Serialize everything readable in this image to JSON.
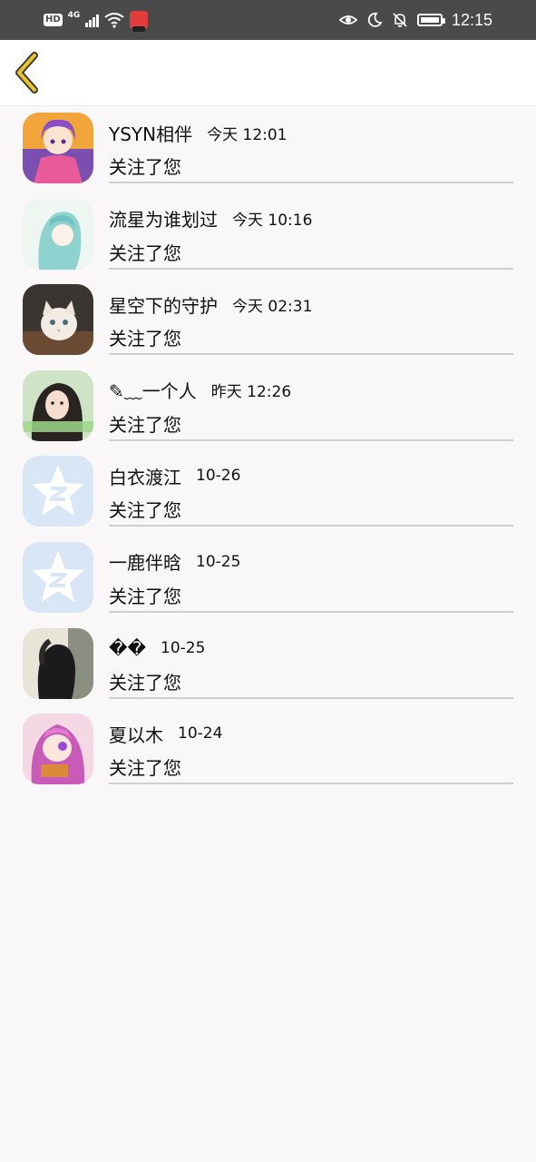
{
  "status_bar": {
    "hd": "HD",
    "network": "4G",
    "time": "12:15"
  },
  "header": {
    "back_icon": "chevron-left-icon",
    "accent_color": "#e7c728"
  },
  "notifications": [
    {
      "name": "YSYN相伴",
      "time": "今天 12:01",
      "action": "关注了您",
      "avatar": "anime-girl"
    },
    {
      "name": "流星为谁划过",
      "time": "今天 10:16",
      "action": "关注了您",
      "avatar": "teal-hair-girl"
    },
    {
      "name": "星空下的守护",
      "time": "今天 02:31",
      "action": "关注了您",
      "avatar": "kitten"
    },
    {
      "name": "✎﹏一个人",
      "time": "昨天 12:26",
      "action": "关注了您",
      "avatar": "photo-girl"
    },
    {
      "name": "白衣渡江",
      "time": "10-26",
      "action": "关注了您",
      "avatar": "default-qzone"
    },
    {
      "name": "一鹿伴晗",
      "time": "10-25",
      "action": "关注了您",
      "avatar": "default-qzone"
    },
    {
      "name": "��",
      "time": "10-25",
      "action": "关注了您",
      "avatar": "dark-hair-girl"
    },
    {
      "name": "夏以木",
      "time": "10-24",
      "action": "关注了您",
      "avatar": "pink-anime-girl"
    }
  ]
}
